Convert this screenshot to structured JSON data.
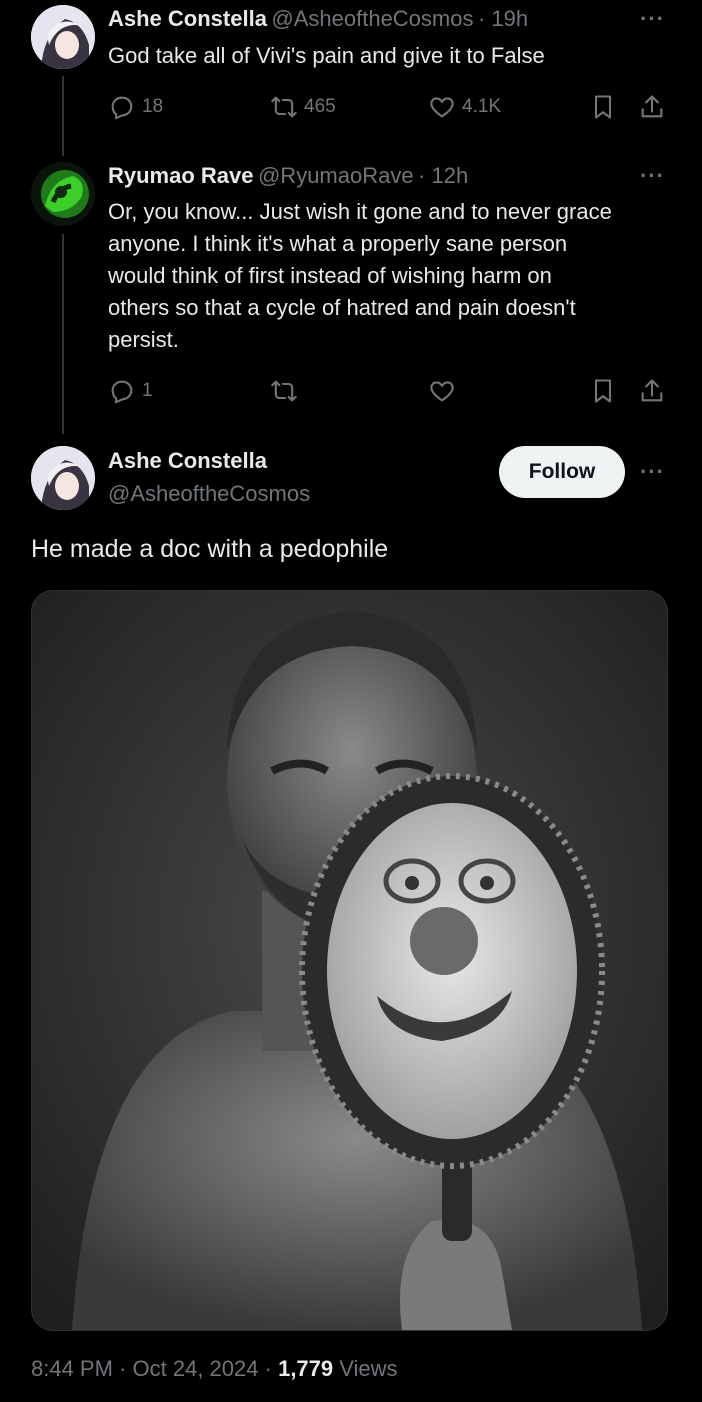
{
  "reply1": {
    "name": "Ashe Constella",
    "handle": "@AsheoftheCosmos",
    "time": "· 19h",
    "text": "God take all of Vivi's pain and give it to False",
    "actions": {
      "replies": "18",
      "reposts": "465",
      "likes": "4.1K"
    }
  },
  "reply2": {
    "name": "Ryumao Rave",
    "handle": "@RyumaoRave",
    "time": "· 12h",
    "lines": [
      "Or, you know... Just wish it gone and to never grace",
      "anyone. I think it's what a properly sane person",
      "would think of first instead of wishing harm on",
      "others so that a cycle of hatred and pain doesn't",
      "persist."
    ],
    "actions": {
      "replies": "1"
    }
  },
  "main": {
    "name": "Ashe Constella",
    "handle": "@AsheoftheCosmos",
    "follow_label": "Follow",
    "text": "He made a doc with a pedophile",
    "time": "8:44 PM",
    "date": "Oct 24, 2024",
    "views_count": "1,779",
    "views_label": "Views"
  },
  "icons": {
    "reply": "reply-icon",
    "repost": "repost-icon",
    "like": "heart-icon",
    "bookmark": "bookmark-icon",
    "share": "share-icon",
    "more": "more-icon"
  },
  "colors": {
    "background": "#000000",
    "text": "#e7e9ea",
    "muted": "#71767b",
    "follow_bg": "#eff3f4"
  }
}
